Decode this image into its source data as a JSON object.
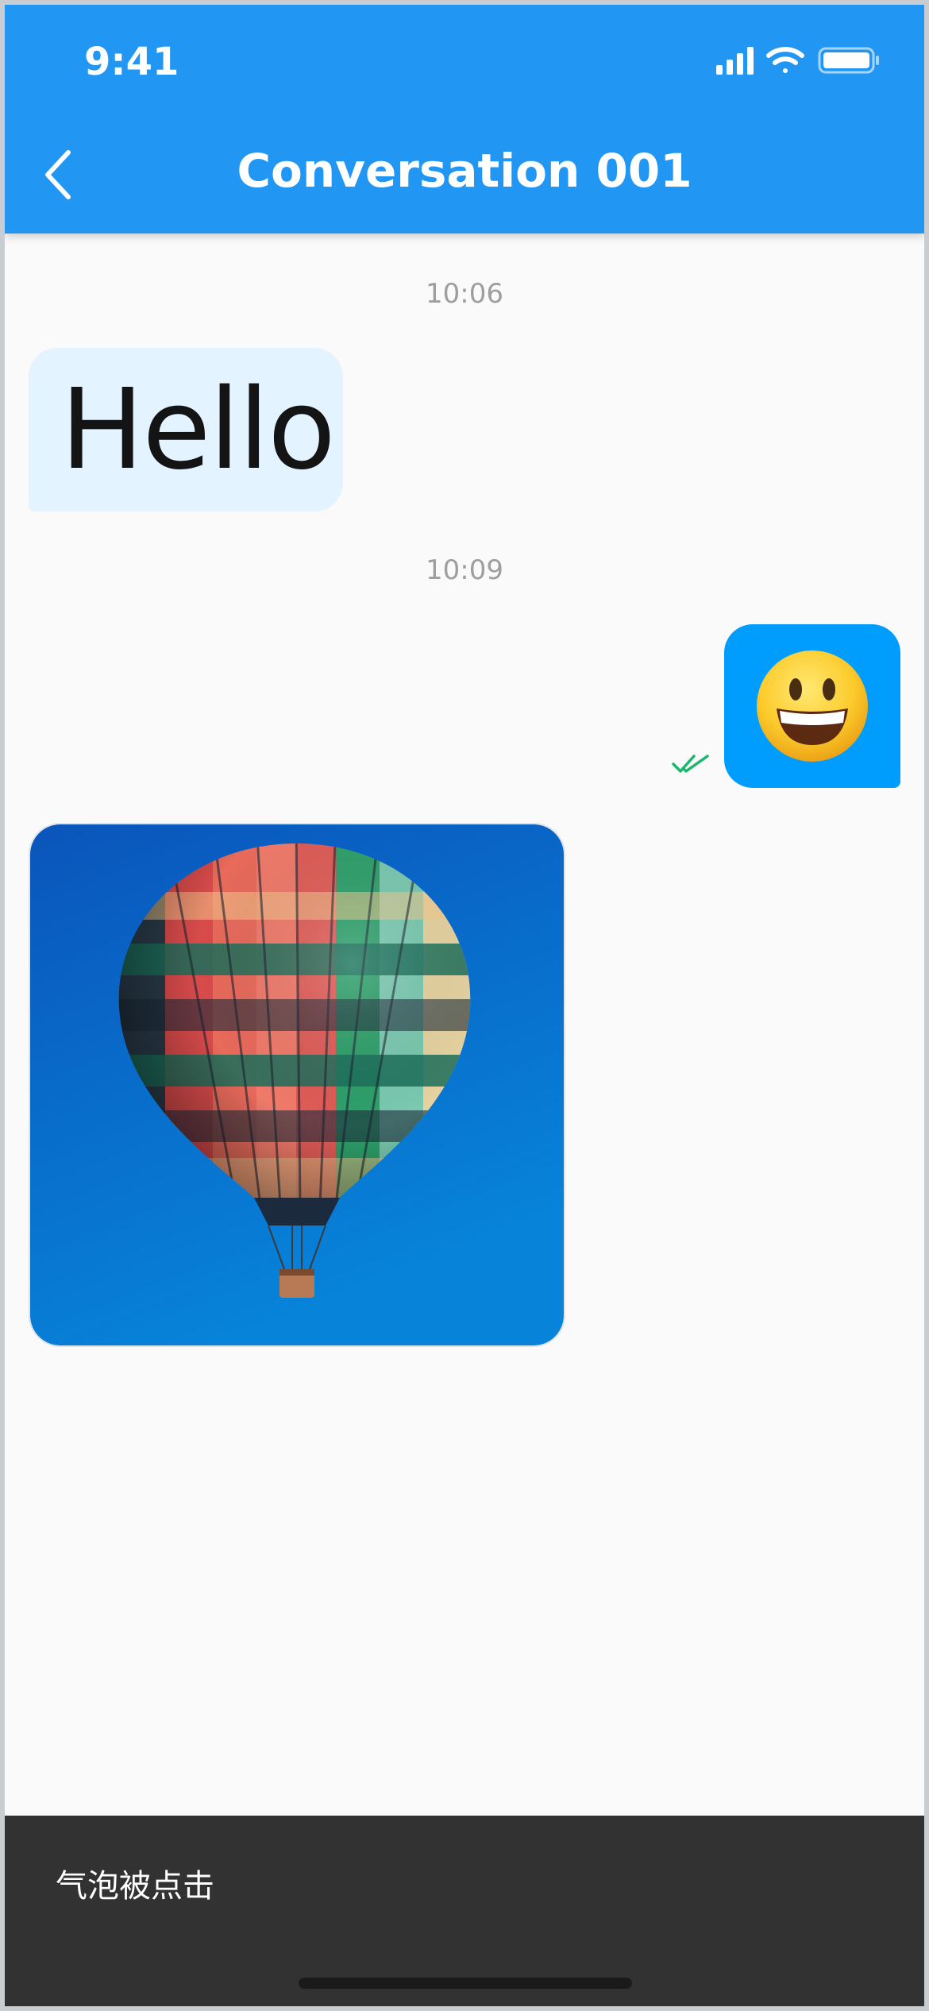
{
  "status_bar": {
    "time": "9:41"
  },
  "header": {
    "title": "Conversation 001"
  },
  "messages": [
    {
      "timestamp": "10:06",
      "direction": "incoming",
      "type": "text",
      "text": "Hello"
    },
    {
      "timestamp": "10:09",
      "direction": "outgoing",
      "type": "emoji",
      "emoji": "grinning-face",
      "status": "read"
    },
    {
      "direction": "incoming",
      "type": "image",
      "image": "hot-air-balloon"
    }
  ],
  "snackbar": {
    "text": "气泡被点击"
  },
  "colors": {
    "appbar": "#2196f3",
    "incoming_bubble": "#e3f3ff",
    "outgoing_bubble": "#009dff",
    "read_check": "#1db76b",
    "snackbar": "#323232"
  }
}
